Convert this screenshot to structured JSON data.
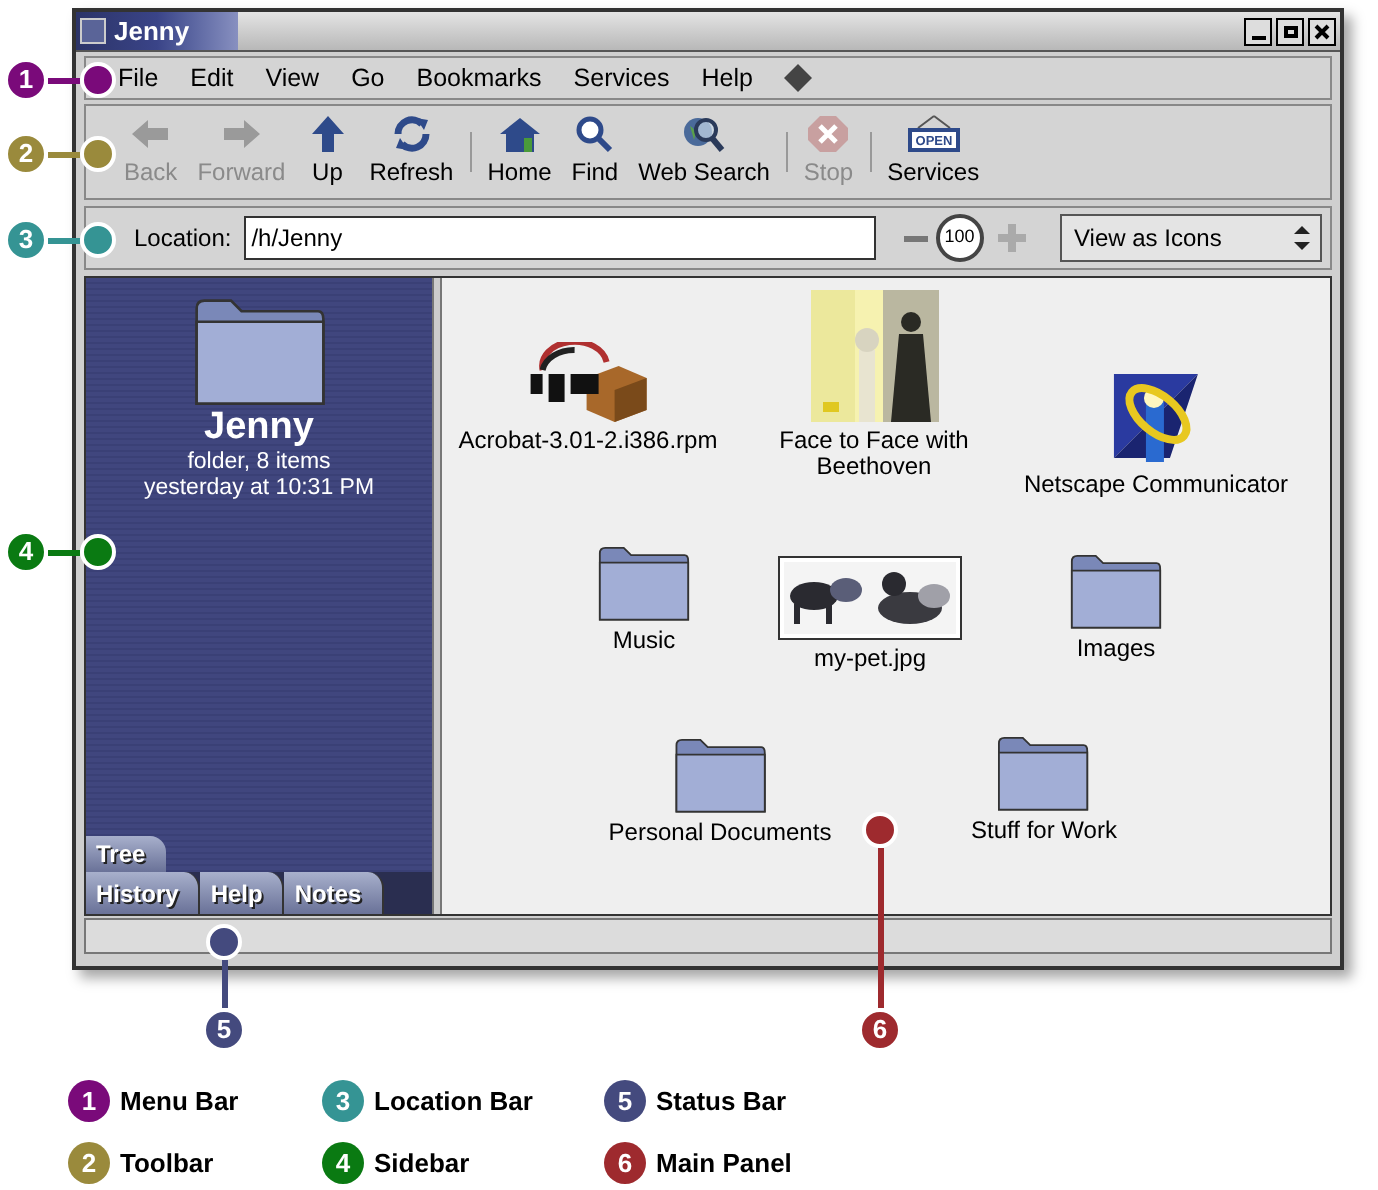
{
  "window": {
    "title": "Jenny"
  },
  "menu_bar": [
    "File",
    "Edit",
    "View",
    "Go",
    "Bookmarks",
    "Services",
    "Help"
  ],
  "toolbar_groups": [
    {
      "items": [
        {
          "kind": "back",
          "label": "Back",
          "disabled": true
        },
        {
          "kind": "forward",
          "label": "Forward",
          "disabled": true
        },
        {
          "kind": "up",
          "label": "Up",
          "disabled": false
        },
        {
          "kind": "refresh",
          "label": "Refresh",
          "disabled": false
        }
      ]
    },
    {
      "items": [
        {
          "kind": "home",
          "label": "Home",
          "disabled": false
        },
        {
          "kind": "find",
          "label": "Find",
          "disabled": false
        },
        {
          "kind": "websearch",
          "label": "Web Search",
          "disabled": false
        }
      ]
    },
    {
      "items": [
        {
          "kind": "stop",
          "label": "Stop",
          "disabled": true
        }
      ]
    },
    {
      "items": [
        {
          "kind": "services",
          "label": "Services",
          "disabled": false,
          "sign": "OPEN"
        }
      ]
    }
  ],
  "location_bar": {
    "label": "Location:",
    "value": "/h/Jenny",
    "zoom": "100",
    "view": "View as Icons"
  },
  "sidebar": {
    "title": "Jenny",
    "info": "folder, 8 items",
    "date": "yesterday at 10:31 PM",
    "tabs_back": [
      "Tree"
    ],
    "tabs_front": [
      "History",
      "Help",
      "Notes"
    ]
  },
  "main_panel": {
    "items": [
      {
        "kind": "package",
        "label": "Acrobat-3.01-2.i386.rpm"
      },
      {
        "kind": "album",
        "label": "Face to Face with Beethoven"
      },
      {
        "kind": "application",
        "label": "Netscape Communicator"
      },
      {
        "kind": "folder",
        "label": "Music"
      },
      {
        "label": "my-pet.jpg"
      },
      {
        "kind": "folder",
        "label": "Images"
      },
      {
        "kind": "folder",
        "label": "Personal Documents"
      },
      {
        "kind": "folder",
        "label": "Stuff for Work"
      }
    ]
  },
  "callouts": [
    {
      "number": "1",
      "color": "#7a0a7a"
    },
    {
      "number": "2",
      "color": "#9a8a3c"
    },
    {
      "number": "3",
      "color": "#359494"
    },
    {
      "number": "4",
      "color": "#0a7a12"
    },
    {
      "number": "5",
      "color": "#444a7e"
    },
    {
      "number": "6",
      "color": "#9e2a2e"
    }
  ],
  "legend": [
    {
      "number": "1",
      "label": "Menu Bar",
      "color": "#7a0a7a"
    },
    {
      "number": "3",
      "label": "Location Bar",
      "color": "#359494"
    },
    {
      "number": "5",
      "label": "Status Bar",
      "color": "#444a7e"
    },
    {
      "number": "2",
      "label": "Toolbar",
      "color": "#9a8a3c"
    },
    {
      "number": "4",
      "label": "Sidebar",
      "color": "#0a7a12"
    },
    {
      "number": "6",
      "label": "Main Panel",
      "color": "#9e2a2e"
    }
  ]
}
